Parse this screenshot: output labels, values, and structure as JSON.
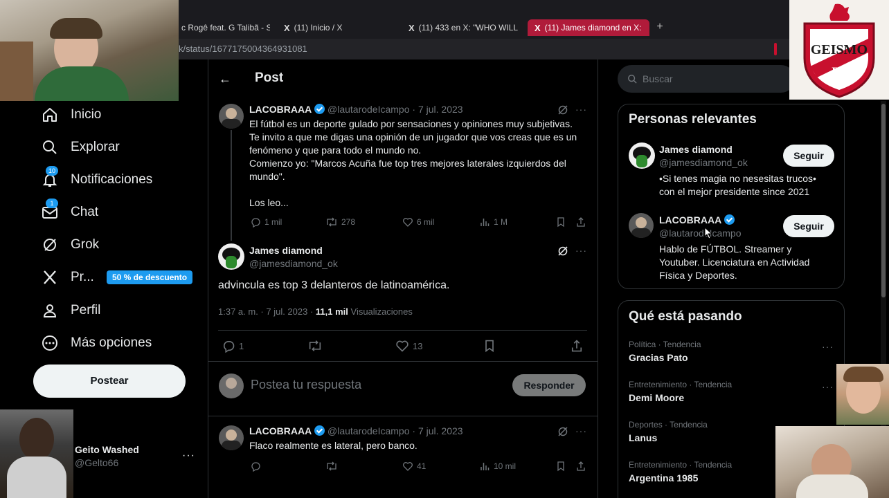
{
  "browser": {
    "tabs": [
      {
        "label": "c Rogê feat. G Talibã - S",
        "active": false
      },
      {
        "label": "(11) Inicio / X",
        "active": false
      },
      {
        "label": "(11) 433 en X: \"WHO WILL",
        "active": false
      },
      {
        "label": "(11) James diamond en X:",
        "active": true
      }
    ],
    "tab_add": "+",
    "url": "k/status/1677175004364931081"
  },
  "nav": {
    "items": [
      {
        "label": "Inicio",
        "icon": "home-icon"
      },
      {
        "label": "Explorar",
        "icon": "search-icon"
      },
      {
        "label": "Notificaciones",
        "icon": "bell-icon",
        "badge": "10"
      },
      {
        "label": "Chat",
        "icon": "mail-icon",
        "badge": "1"
      },
      {
        "label": "Grok",
        "icon": "grok-icon"
      },
      {
        "label": "Pr...",
        "icon": "x-logo-icon"
      },
      {
        "label": "Perfil",
        "icon": "person-icon"
      },
      {
        "label": "Más opciones",
        "icon": "more-circle-icon"
      }
    ],
    "promo": "50 % de descuento",
    "post_button": "Postear",
    "account": {
      "name": "Geito Washed",
      "handle": "@Gelto66",
      "more": "···"
    }
  },
  "main": {
    "title": "Post",
    "parent_tweet": {
      "name": "LACOBRAAA",
      "handle_date": "@lautarodeIcampo · 7 jul. 2023",
      "text": "El fútbol es un deporte gulado por sensaciones y opiniones muy subjetivas.\nTe invito a que me digas una opinión de un jugador que vos creas que es un\nfenómeno y que para todo el mundo no.\nComienzo yo: \"Marcos Acuña fue top tres mejores laterales izquierdos del\nmundo\".\n\nLos leo...",
      "replies": "1 mil",
      "retweets": "278",
      "likes": "6 mil",
      "views": "1 M"
    },
    "main_tweet": {
      "name": "James diamond",
      "handle": "@jamesdiamond_ok",
      "text": "advincula es top 3 delanteros de latinoamérica.",
      "time": "1:37 a. m. · 7 jul. 2023 · ",
      "views_count": "11,1 mil",
      "views_label": " Visualizaciones",
      "replies": "1",
      "likes": "13"
    },
    "reply_box": {
      "placeholder": "Postea tu respuesta",
      "button": "Responder"
    },
    "reply_tweet": {
      "name": "LACOBRAAA",
      "handle_date": "@lautarodeIcampo · 7 jul. 2023",
      "text": "Flaco realmente es lateral, pero banco.",
      "likes": "41",
      "views": "10 mil"
    }
  },
  "sidebar": {
    "search_placeholder": "Buscar",
    "relevant": {
      "title": "Personas relevantes",
      "people": [
        {
          "name": "James diamond",
          "handle": "@jamesdiamond_ok",
          "bio": "•Si tenes magia no nesesitas trucos•\ncon el mejor presidente since 2021",
          "button": "Seguir"
        },
        {
          "name": "LACOBRAAA",
          "handle": "@lautarodeIcampo",
          "bio": "Hablo de FÚTBOL. Streamer y\nYoutuber. Licenciatura en Actividad\nFísica y Deportes.",
          "button": "Seguir"
        }
      ]
    },
    "trends": {
      "title": "Qué está pasando",
      "items": [
        {
          "category": "Política · Tendencia",
          "name": "Gracias Pato"
        },
        {
          "category": "Entretenimiento · Tendencia",
          "name": "Demi Moore"
        },
        {
          "category": "Deportes · Tendencia",
          "name": "Lanus"
        },
        {
          "category": "Entretenimiento · Tendencia",
          "name": "Argentina 1985"
        }
      ]
    }
  },
  "logo": {
    "text_top": "GEISMO",
    "text_bottom": "FC"
  },
  "colors": {
    "accent": "#1d9bf0",
    "tab_active": "#b01b3a",
    "logo_red": "#c8102e"
  }
}
